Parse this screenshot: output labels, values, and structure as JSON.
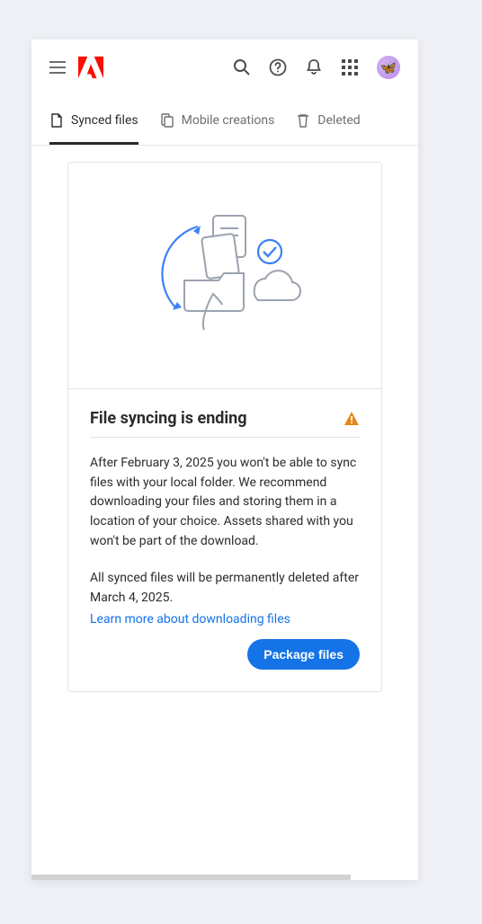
{
  "header": {
    "icons": {
      "menu": "menu-icon",
      "search": "search-icon",
      "help": "help-icon",
      "notifications": "bell-icon",
      "apps": "apps-grid-icon",
      "avatar": "avatar"
    }
  },
  "tabs": [
    {
      "id": "synced",
      "label": "Synced files",
      "active": true,
      "icon": "file-icon"
    },
    {
      "id": "mobile",
      "label": "Mobile creations",
      "active": false,
      "icon": "mobile-icon"
    },
    {
      "id": "deleted",
      "label": "Deleted",
      "active": false,
      "icon": "trash-icon"
    }
  ],
  "card": {
    "title": "File syncing is ending",
    "warning_icon": "warning-triangle-icon",
    "paragraph1": "After February 3, 2025 you won't be able to sync files with your local folder. We recommend downloading your files and storing them in a location of your choice. Assets shared with you won't be part of the download.",
    "paragraph2": "All synced files will be permanently deleted after March 4, 2025.",
    "link_text": "Learn more about downloading files",
    "button_label": "Package files"
  }
}
